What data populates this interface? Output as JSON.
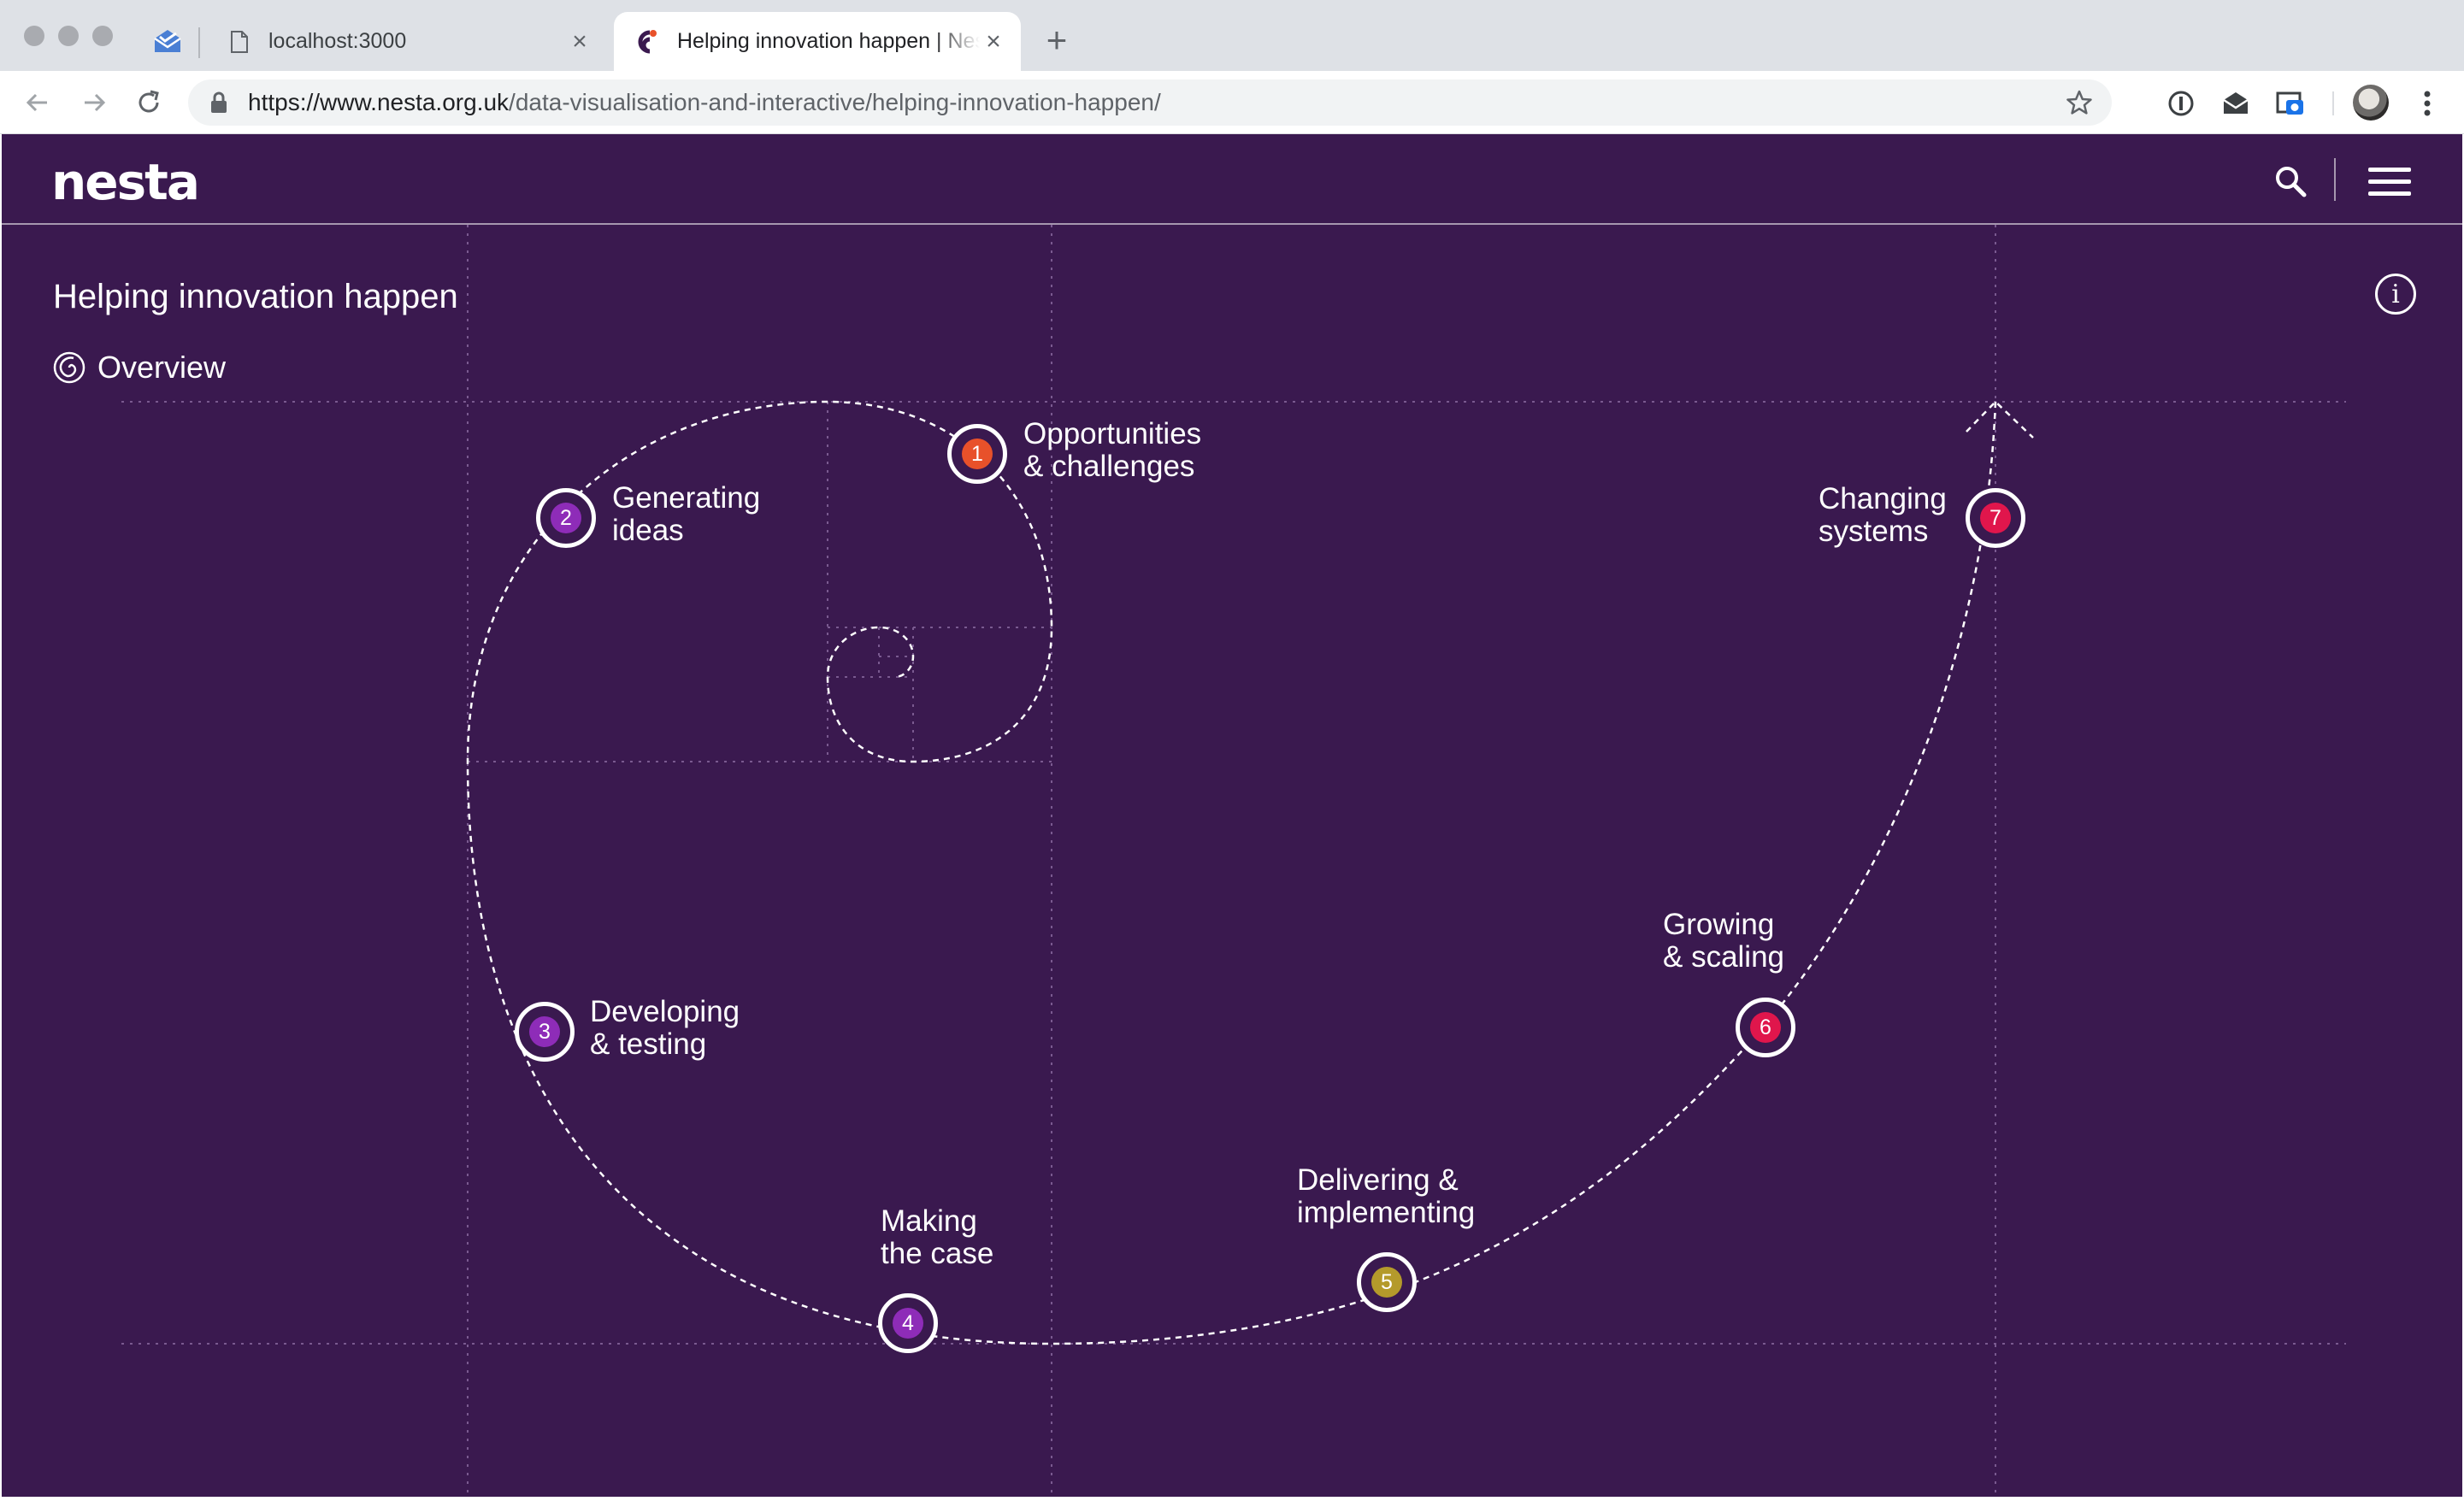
{
  "browser": {
    "tabs": [
      {
        "title": "localhost:3000",
        "active": false,
        "icon": "page-icon"
      },
      {
        "title": "Helping innovation happen | Nesta",
        "active": true,
        "icon": "nesta-favicon"
      }
    ],
    "pinned_icon": "mail-icon",
    "new_tab_symbol": "+",
    "close_symbol": "×",
    "url": {
      "host": "https://www.nesta.org.uk",
      "path": "/data-visualisation-and-interactive/helping-innovation-happen/"
    },
    "extensions": [
      "info-extension-icon",
      "mail-extension-icon",
      "screenshot-extension-icon"
    ]
  },
  "site": {
    "logo": "nesta",
    "title": "Helping innovation happen",
    "overview_label": "Overview",
    "info_symbol": "i"
  },
  "stages": [
    {
      "number": "1",
      "label": "Opportunities\n& challenges",
      "color": "#e8512a"
    },
    {
      "number": "2",
      "label": "Generating\nideas",
      "color": "#8e2cb8"
    },
    {
      "number": "3",
      "label": "Developing\n& testing",
      "color": "#8e2cb8"
    },
    {
      "number": "4",
      "label": "Making\nthe case",
      "color": "#8e2cb8"
    },
    {
      "number": "5",
      "label": "Delivering &\nimplementing",
      "color": "#b49a2b"
    },
    {
      "number": "6",
      "label": "Growing\n& scaling",
      "color": "#e0164c"
    },
    {
      "number": "7",
      "label": "Changing\nsystems",
      "color": "#e0164c"
    }
  ],
  "colors": {
    "background": "#3a194f",
    "line": "#ffffff"
  }
}
